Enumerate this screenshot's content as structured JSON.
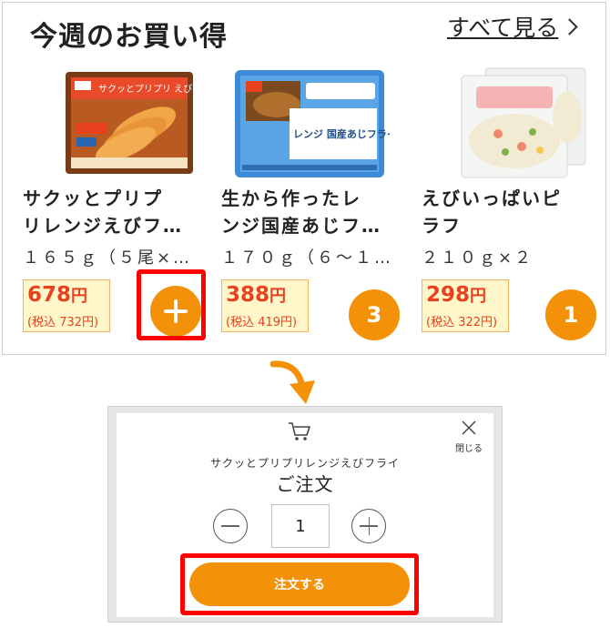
{
  "deals": {
    "title": "今週のお買い得",
    "see_all": "すべて見る",
    "products": [
      {
        "name": "サクッとプリプ\nリレンジえびフ…",
        "qty": "１６５ｇ（５尾×…",
        "price": "678",
        "yen": "円",
        "tax_price": "(税込 732円)",
        "button": "plus",
        "image_caption": "サクッとプリプリ えびフライ"
      },
      {
        "name": "生から作ったレ\nンジ国産あじフ…",
        "qty": "１７０ｇ（６～１…",
        "price": "388",
        "yen": "円",
        "tax_price": "(税込 419円)",
        "button_count": "3",
        "image_caption": "レンジ 国産あじフライ"
      },
      {
        "name": "えびいっぱいピ\nラフ",
        "qty": "２１０ｇ×２",
        "price": "298",
        "yen": "円",
        "tax_price": "(税込 322円)",
        "button_count": "1"
      }
    ]
  },
  "dialog": {
    "product_name": "サクッとプリプリレンジえびフライ",
    "title": "ご注文",
    "close_label": "閉じる",
    "quantity": "1",
    "order_button": "注文する"
  },
  "colors": {
    "accent_orange": "#f39109",
    "price_red": "#e9401e",
    "highlight_red": "#ff0000"
  },
  "icons": [
    "cart-icon",
    "close-icon",
    "plus-icon",
    "minus-icon",
    "chevron-right-icon",
    "down-arrow-icon"
  ]
}
